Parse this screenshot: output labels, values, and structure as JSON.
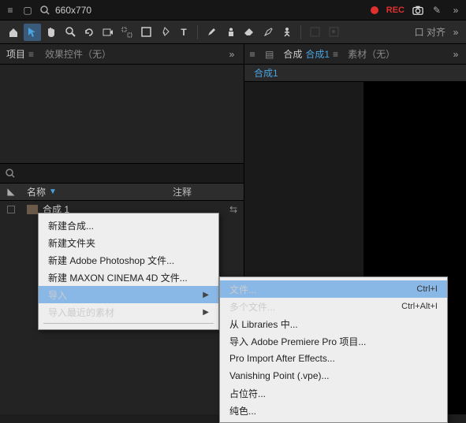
{
  "topbar": {
    "search_value": "660x770",
    "rec_label": "REC"
  },
  "toolbar": {
    "align_label": "口 对齐"
  },
  "left_panel": {
    "tab_project": "项目",
    "tab_effects": "效果控件（无）",
    "col_name": "名称",
    "col_comment": "注释",
    "item1": "合成 1"
  },
  "right_panel": {
    "marker_icon": "■",
    "tab_comp_prefix": "合成",
    "tab_comp_active": "合成1",
    "tab_footage": "素材（无）",
    "sub_tab": "合成1"
  },
  "menu1": {
    "new_comp": "新建合成...",
    "new_folder": "新建文件夹",
    "new_ps": "新建 Adobe Photoshop 文件...",
    "new_c4d": "新建 MAXON CINEMA 4D 文件...",
    "import": "导入",
    "import_recent": "导入最近的素材"
  },
  "menu2": {
    "file": "文件...",
    "file_sc": "Ctrl+I",
    "multi": "多个文件...",
    "multi_sc": "Ctrl+Alt+I",
    "libs": "从 Libraries 中...",
    "pp": "导入 Adobe Premiere Pro 项目...",
    "pro_import": "Pro Import After Effects...",
    "vanishing": "Vanishing Point (.vpe)...",
    "placeholder": "占位符...",
    "solid": "纯色..."
  }
}
